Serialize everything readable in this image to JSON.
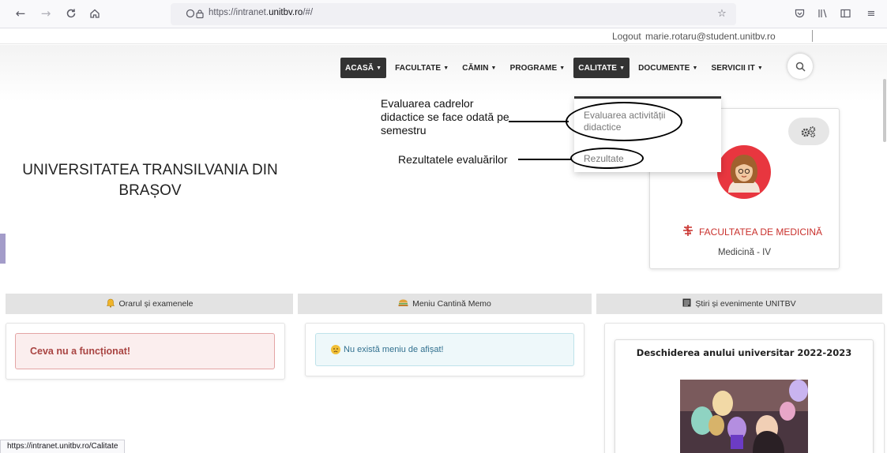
{
  "browser": {
    "url_prefix": "https://intranet.",
    "url_domain": "unitbv.ro",
    "url_suffix": "/#/",
    "status_url": "https://intranet.unitbv.ro/Calitate"
  },
  "user_bar": {
    "logout": "Logout",
    "email": "marie.rotaru@student.unitbv.ro"
  },
  "nav": {
    "items": [
      {
        "label": "ACASĂ",
        "dark": true
      },
      {
        "label": "FACULTATE",
        "dark": false
      },
      {
        "label": "CĂMIN",
        "dark": false
      },
      {
        "label": "PROGRAME",
        "dark": false
      },
      {
        "label": "CALITATE",
        "dark": true
      },
      {
        "label": "DOCUMENTE",
        "dark": false
      },
      {
        "label": "SERVICII IT",
        "dark": false
      }
    ]
  },
  "dropdown": {
    "item1": "Evaluarea activității didactice",
    "item2": "Rezultate"
  },
  "annotations": {
    "note1": "Evaluarea cadrelor didactice se face odată pe semestru",
    "note2": "Rezultatele evaluărilor"
  },
  "university": {
    "title_line1": "UNIVERSITATEA TRANSILVANIA DIN",
    "title_line2": "BRAȘOV"
  },
  "profile": {
    "faculty": "FACULTATEA DE MEDICINĂ",
    "program": "Medicină - IV"
  },
  "sections": {
    "schedule": "Orarul și examenele",
    "canteen": "Meniu Cantină Memo",
    "news": "Știri și evenimente UNITBV"
  },
  "messages": {
    "error": "Ceva nu a funcționat!",
    "menu_empty": "Nu există meniu de afișat!"
  },
  "news": {
    "headline": "Deschiderea anului universitar 2022-2023"
  },
  "colors": {
    "nav_dark": "#333333",
    "faculty_red": "#c9302c",
    "avatar_bg": "#e8363f",
    "error_text": "#a94442",
    "info_text": "#31708f"
  },
  "icons": {
    "back": "arrow-left-icon",
    "forward": "arrow-right-icon",
    "reload": "reload-icon",
    "home": "home-icon",
    "search": "search-icon",
    "settings": "gears-icon",
    "bell": "bell-icon",
    "food": "food-icon",
    "news": "newspaper-icon"
  }
}
